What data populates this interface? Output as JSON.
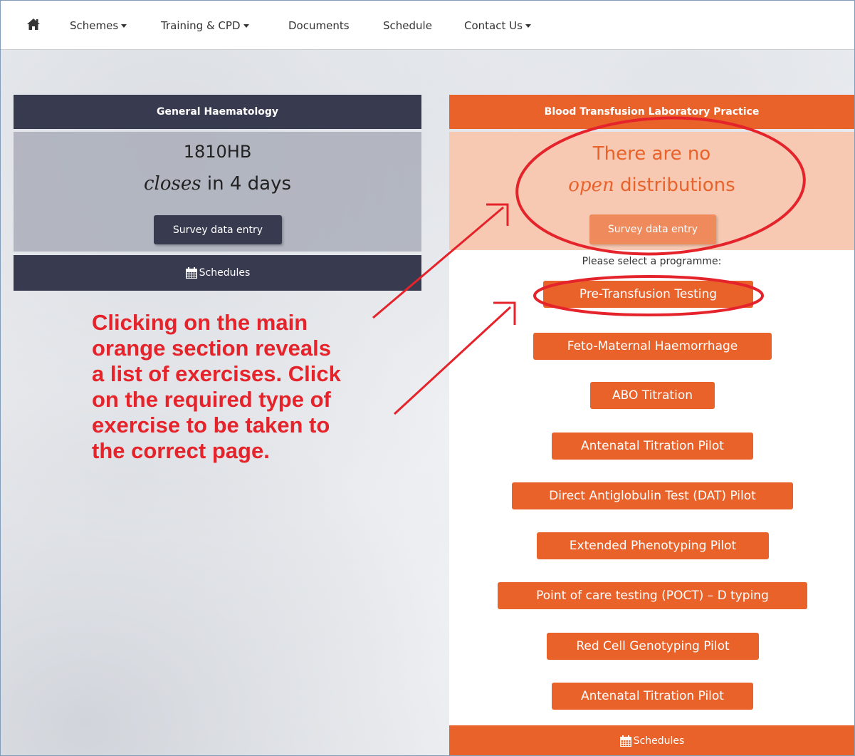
{
  "nav": {
    "home_icon": "home-icon",
    "items": [
      {
        "label": "Schemes",
        "has_caret": true
      },
      {
        "label": "Training & CPD",
        "has_caret": true
      },
      {
        "label": "Documents",
        "has_caret": false
      },
      {
        "label": "Schedule",
        "has_caret": false
      },
      {
        "label": "Contact Us",
        "has_caret": true
      }
    ]
  },
  "left_panel": {
    "title": "General Haematology",
    "code": "1810HB",
    "closes_word": "closes",
    "closes_rest": " in 4 days",
    "button": "Survey data entry",
    "schedules": "Schedules"
  },
  "right_panel": {
    "title": "Blood Transfusion Laboratory Practice",
    "status_line1": "There are no",
    "status_open": "open",
    "status_rest": " distributions",
    "button": "Survey data entry",
    "select_label": "Please select a programme:",
    "programmes": [
      "Pre-Transfusion Testing",
      "Feto-Maternal Haemorrhage",
      "ABO Titration",
      "Antenatal Titration Pilot",
      "Direct Antiglobulin Test (DAT) Pilot",
      "Extended Phenotyping Pilot",
      "Point of care testing (POCT) – D typing",
      "Red Cell Genotyping Pilot",
      "Antenatal Titration Pilot"
    ],
    "schedules": "Schedules"
  },
  "annotation": {
    "lines": [
      "Clicking on the main",
      "orange section reveals",
      "a list of exercises. Click",
      "on the required type of",
      "exercise to be taken to",
      "the correct page."
    ]
  },
  "colors": {
    "dark_navy": "#383a4f",
    "orange": "#e8622a",
    "peach": "#f7c9b3",
    "annotation_red": "#e5232b"
  }
}
